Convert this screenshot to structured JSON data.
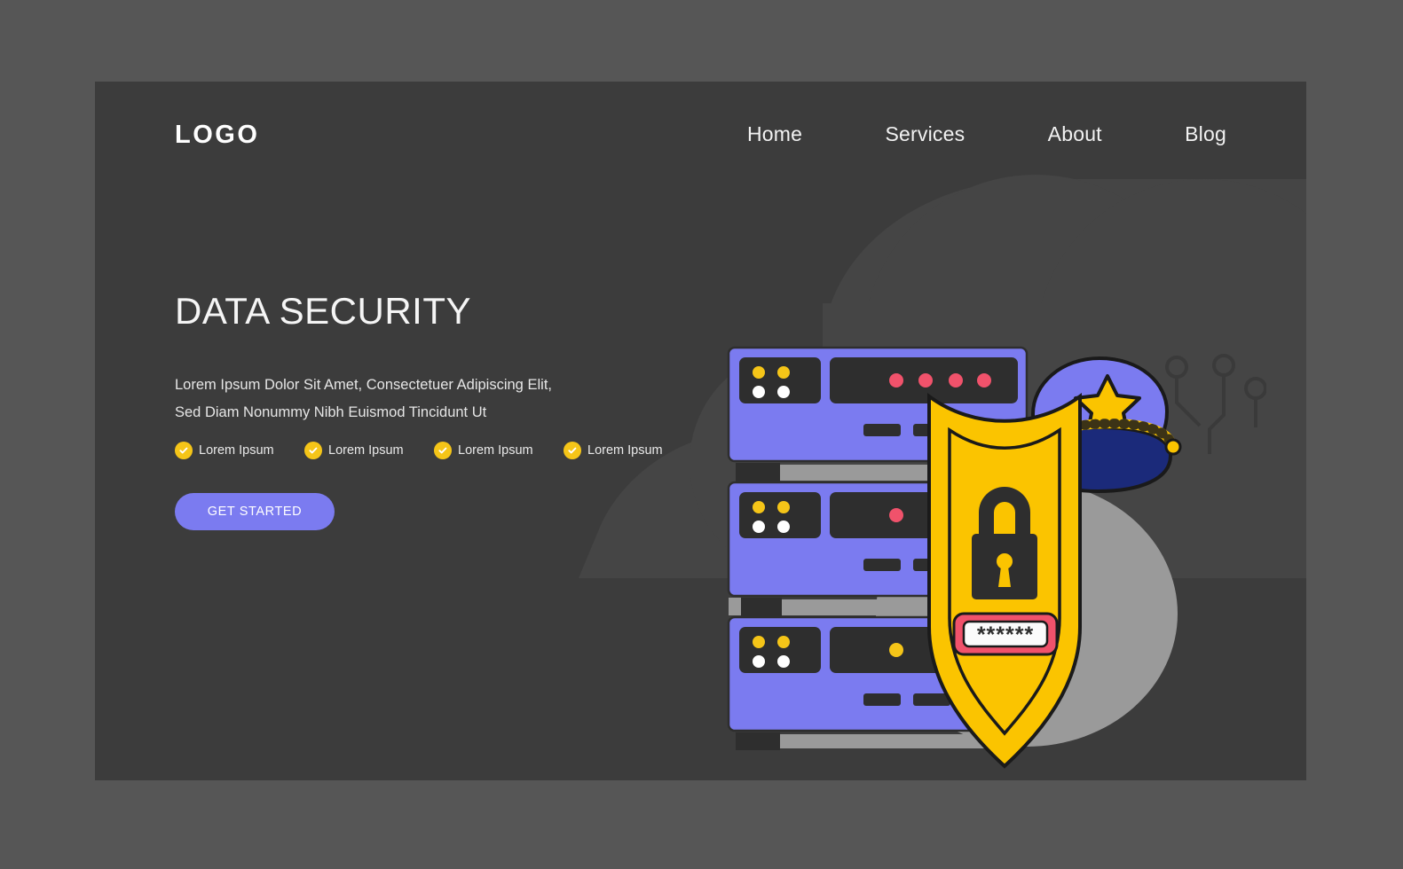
{
  "page": {
    "background_color": "#565656",
    "panel_color": "#3c3c3c",
    "cloud_color": "#454545"
  },
  "header": {
    "logo": "LOGO",
    "nav": [
      {
        "label": "Home"
      },
      {
        "label": "Services"
      },
      {
        "label": "About"
      },
      {
        "label": "Blog"
      }
    ]
  },
  "hero": {
    "title": "DATA SECURITY",
    "description": "Lorem Ipsum Dolor Sit Amet, Consectetuer Adipiscing Elit, Sed Diam Nonummy Nibh Euismod Tincidunt Ut",
    "features": [
      {
        "label": "Lorem Ipsum",
        "icon": "check-circle-icon"
      },
      {
        "label": "Lorem Ipsum",
        "icon": "check-circle-icon"
      },
      {
        "label": "Lorem Ipsum",
        "icon": "check-circle-icon"
      },
      {
        "label": "Lorem Ipsum",
        "icon": "check-circle-icon"
      }
    ],
    "cta_label": "GET STARTED"
  },
  "illustration": {
    "name": "data-security-illustration",
    "password_field_value": "******",
    "colors": {
      "server_body": "#7b7bf0",
      "server_panel": "#2e2e2e",
      "shield_yellow": "#fbc400",
      "cap_crown": "#7b7bf0",
      "cap_band": "#1b2a7a",
      "password_frame": "#f0526b",
      "password_field": "#fbfbfb",
      "lock_body": "#2e2e2e",
      "blob_gray": "#9a9a9a",
      "accent_pink": "#f0526b",
      "accent_yellow": "#f5c518",
      "circuit_line": "#3a3a3a"
    },
    "parts": [
      "server-rack-top",
      "server-rack-middle",
      "server-rack-bottom",
      "police-cap",
      "shield",
      "padlock",
      "password-field",
      "circuit-traces"
    ]
  }
}
